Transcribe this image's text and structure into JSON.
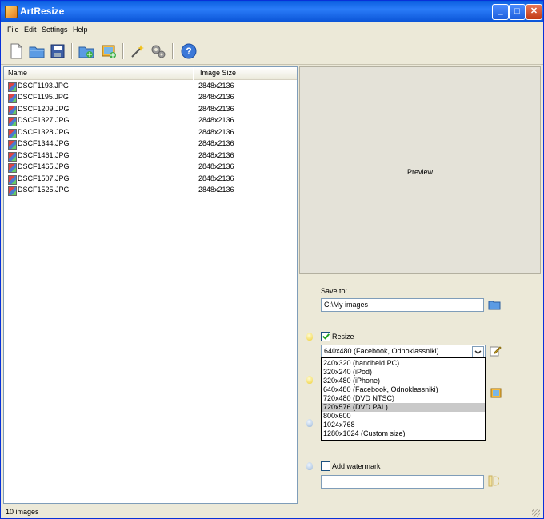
{
  "window": {
    "title": "ArtResize"
  },
  "menu": [
    "File",
    "Edit",
    "Settings",
    "Help"
  ],
  "list": {
    "columns": [
      "Name",
      "Image Size"
    ],
    "files": [
      {
        "name": "DSCF1193.JPG",
        "size": "2848x2136"
      },
      {
        "name": "DSCF1195.JPG",
        "size": "2848x2136"
      },
      {
        "name": "DSCF1209.JPG",
        "size": "2848x2136"
      },
      {
        "name": "DSCF1327.JPG",
        "size": "2848x2136"
      },
      {
        "name": "DSCF1328.JPG",
        "size": "2848x2136"
      },
      {
        "name": "DSCF1344.JPG",
        "size": "2848x2136"
      },
      {
        "name": "DSCF1461.JPG",
        "size": "2848x2136"
      },
      {
        "name": "DSCF1465.JPG",
        "size": "2848x2136"
      },
      {
        "name": "DSCF1507.JPG",
        "size": "2848x2136"
      },
      {
        "name": "DSCF1525.JPG",
        "size": "2848x2136"
      }
    ]
  },
  "preview": {
    "label": "Preview"
  },
  "settings": {
    "save_to_label": "Save to:",
    "save_to_value": "C:\\My images",
    "resize_label": "Resize",
    "resize_checked": true,
    "resize_selected": "640x480 (Facebook, Odnoklassniki)",
    "resize_options": [
      "240x320 (handheld PC)",
      "320x240 (iPod)",
      "320x480 (iPhone)",
      "640x480 (Facebook, Odnoklassniki)",
      "720x480 (DVD NTSC)",
      "720x576 (DVD PAL)",
      "800x600",
      "1024x768",
      "1280x1024 (Custom size)"
    ],
    "highlighted_option_index": 5,
    "watermark_label": "Add watermark",
    "watermark_checked": false,
    "watermark_value": ""
  },
  "status": {
    "text": "10 images"
  }
}
